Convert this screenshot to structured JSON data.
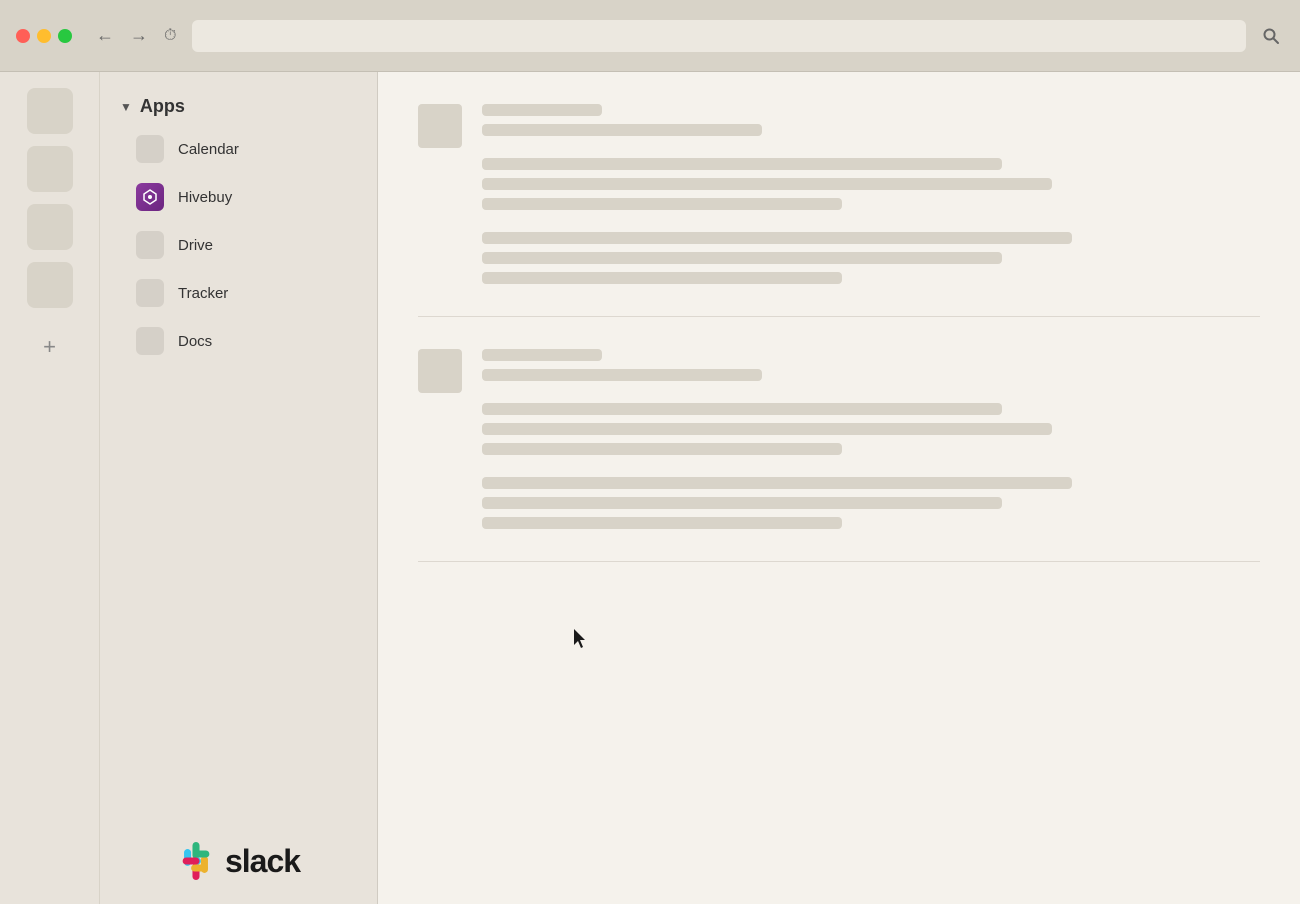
{
  "browser": {
    "back_btn": "←",
    "forward_btn": "→",
    "history_btn": "⏱",
    "search_icon": "🔍",
    "address_placeholder": ""
  },
  "sidebar_icons": [
    {
      "id": "icon-1"
    },
    {
      "id": "icon-2"
    },
    {
      "id": "icon-3"
    },
    {
      "id": "icon-4"
    }
  ],
  "add_label": "+",
  "nav": {
    "apps_label": "Apps",
    "chevron": "▼",
    "items": [
      {
        "id": "calendar",
        "label": "Calendar",
        "has_icon": false
      },
      {
        "id": "hivebuy",
        "label": "Hivebuy",
        "has_icon": true
      },
      {
        "id": "drive",
        "label": "Drive",
        "has_icon": false
      },
      {
        "id": "tracker",
        "label": "Tracker",
        "has_icon": false
      },
      {
        "id": "docs",
        "label": "Docs",
        "has_icon": false
      }
    ]
  },
  "slack": {
    "logo_text": "slack"
  },
  "content": {
    "post1": {
      "title_line1": "",
      "title_line2": "",
      "body_lines": [
        "",
        "",
        ""
      ],
      "body2_lines": [
        "",
        "",
        ""
      ]
    },
    "post2": {
      "title_line1": "",
      "title_line2": "",
      "body_lines": [
        "",
        "",
        ""
      ],
      "body2_lines": [
        "",
        "",
        ""
      ]
    }
  }
}
